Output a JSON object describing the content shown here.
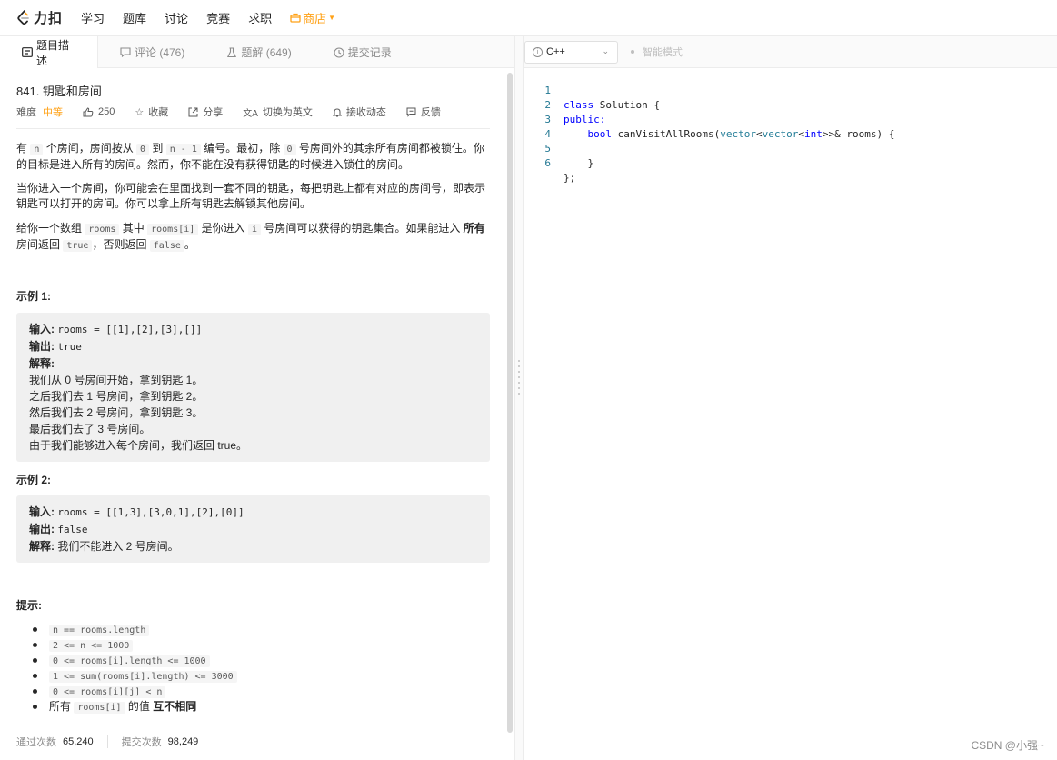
{
  "nav": {
    "logo_text": "力扣",
    "items": [
      "学习",
      "题库",
      "讨论",
      "竞赛",
      "求职"
    ],
    "store_label": "商店"
  },
  "left_tabs": [
    {
      "label": "题目描述"
    },
    {
      "label": "评论 (476)"
    },
    {
      "label": "题解 (649)"
    },
    {
      "label": "提交记录"
    }
  ],
  "problem": {
    "title": "841. 钥匙和房间",
    "difficulty_label": "难度",
    "difficulty_value": "中等",
    "likes": "250",
    "favorite_label": "收藏",
    "share_label": "分享",
    "switch_lang_label": "切换为英文",
    "subscribe_label": "接收动态",
    "feedback_label": "反馈",
    "desc1": {
      "t1": "有 ",
      "c1": "n",
      "t2": " 个房间，房间按从 ",
      "c2": "0",
      "t3": " 到 ",
      "c3": "n - 1",
      "t4": " 编号。最初，除 ",
      "c4": "0",
      "t5": " 号房间外的其余所有房间都被锁住。你的目标是进入所有的房间。然而，你不能在没有获得钥匙的时候进入锁住的房间。"
    },
    "desc2": "当你进入一个房间，你可能会在里面找到一套不同的钥匙，每把钥匙上都有对应的房间号，即表示钥匙可以打开的房间。你可以拿上所有钥匙去解锁其他房间。",
    "desc3": {
      "t1": "给你一个数组 ",
      "c1": "rooms",
      "t2": " 其中 ",
      "c2": "rooms[i]",
      "t3": " 是你进入 ",
      "c3": "i",
      "t4": " 号房间可以获得的钥匙集合。如果能进入 ",
      "b1": "所有",
      "t5": " 房间返回 ",
      "c4": "true",
      "t6": "，否则返回 ",
      "c5": "false",
      "t7": "。"
    },
    "example1": {
      "heading": "示例 1:",
      "input_label": "输入:",
      "input_value": "rooms = [[1],[2],[3],[]]",
      "output_label": "输出:",
      "output_value": "true",
      "explain_label": "解释:",
      "lines": [
        "我们从 0 号房间开始，拿到钥匙 1。",
        "之后我们去 1 号房间，拿到钥匙 2。",
        "然后我们去 2 号房间，拿到钥匙 3。",
        "最后我们去了 3 号房间。",
        "由于我们能够进入每个房间，我们返回 true。"
      ]
    },
    "example2": {
      "heading": "示例 2:",
      "input_label": "输入:",
      "input_value": "rooms = [[1,3],[3,0,1],[2],[0]]",
      "output_label": "输出:",
      "output_value": "false",
      "explain_label": "解释:",
      "explain_value": "我们不能进入 2 号房间。"
    },
    "hints_heading": "提示:",
    "hints": [
      "n == rooms.length",
      "2 <= n <= 1000",
      "0 <= rooms[i].length <= 1000",
      "1 <= sum(rooms[i].length) <= 3000",
      "0 <= rooms[i][j] < n"
    ],
    "hint_last": {
      "t1": "所有 ",
      "c1": "rooms[i]",
      "t2": " 的值 ",
      "b1": "互不相同"
    },
    "stats": {
      "passed_label": "通过次数",
      "passed_value": "65,240",
      "submitted_label": "提交次数",
      "submitted_value": "98,249"
    }
  },
  "editor": {
    "language": "C++",
    "smart_mode_label": "智能模式",
    "line_numbers": [
      "1",
      "2",
      "3",
      "4",
      "5",
      "6"
    ],
    "lines": {
      "l1a": "class",
      "l1b": " Solution {",
      "l2": "public:",
      "l3a": "    ",
      "l3b": "bool",
      "l3c": " canVisitAllRooms(",
      "l3d": "vector",
      "l3e": "<",
      "l3f": "vector",
      "l3g": "<",
      "l3h": "int",
      "l3i": ">>& rooms) {",
      "l4": "",
      "l5": "    }",
      "l6": "};"
    }
  },
  "watermark": "CSDN @小强~",
  "colors": {
    "accent": "#ffa116",
    "keyword": "#0000ff",
    "type": "#267f99",
    "line_number": "#237893"
  }
}
